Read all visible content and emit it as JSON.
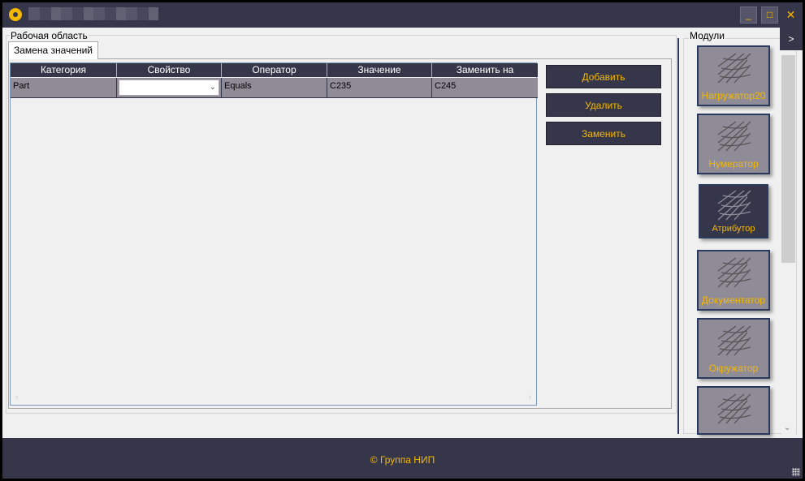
{
  "window": {
    "minimize_glyph": "_",
    "maximize_glyph": "□",
    "close_glyph": "✕"
  },
  "workspace": {
    "group_label": "Рабочая область",
    "tab_label": "Замена значений"
  },
  "grid": {
    "columns": [
      "Категория",
      "Свойство",
      "Оператор",
      "Значение",
      "Заменить на"
    ],
    "rows": [
      {
        "category": "Part",
        "property": "",
        "operator": "Equals",
        "value": "C235",
        "replace_with": "C245"
      }
    ]
  },
  "actions": {
    "add": "Добавить",
    "delete": "Удалить",
    "replace": "Заменить"
  },
  "modules": {
    "label": "Модули",
    "expand_glyph": ">",
    "items": [
      {
        "label": "Нагружатор20",
        "active": false
      },
      {
        "label": "Нумератор",
        "active": false
      },
      {
        "label": "Атрибутор",
        "active": true
      },
      {
        "label": "Документатор",
        "active": false
      },
      {
        "label": "Окружатор",
        "active": false
      },
      {
        "label": "",
        "active": false
      }
    ]
  },
  "footer": {
    "text": "© Группа НИП"
  },
  "colors": {
    "dark": "#36364a",
    "accent": "#f5b800",
    "row_bg": "#8f8c98"
  }
}
